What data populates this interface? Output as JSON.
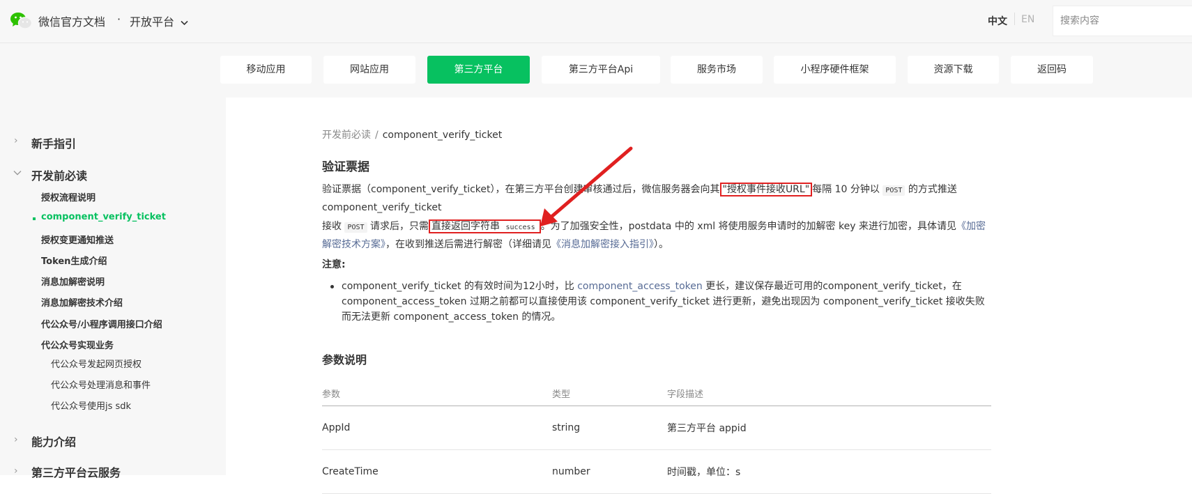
{
  "header": {
    "site_title": "微信官方文档",
    "separator": "·",
    "platform": "开放平台",
    "lang_zh": "中文",
    "lang_en": "EN",
    "search_placeholder": "搜索内容"
  },
  "product_nav": {
    "items": [
      "移动应用",
      "网站应用",
      "第三方平台",
      "第三方平台Api",
      "服务市场",
      "小程序硬件框架",
      "资源下载",
      "返回码"
    ],
    "active_index": 2
  },
  "sidebar": {
    "sections": [
      "新手指引",
      "开发前必读",
      "能力介绍",
      "第三方平台云服务"
    ],
    "sub_items": [
      "授权流程说明",
      "component_verify_ticket",
      "授权变更通知推送",
      "Token生成介绍",
      "消息加解密说明",
      "消息加解密技术介绍",
      "代公众号/小程序调用接口介绍",
      "代公众号实现业务"
    ],
    "sub_sub_items": [
      "代公众号发起网页授权",
      "代公众号处理消息和事件",
      "代公众号使用js sdk"
    ]
  },
  "content": {
    "breadcrumb_parent": "开发前必读",
    "breadcrumb_sep": "/",
    "breadcrumb_current": "component_verify_ticket",
    "title": "验证票据",
    "p1": {
      "a": "验证票据（component_verify_ticket），在第三方平台创建审核通过后，微信服务器会向其",
      "highlight": "\"授权事件接收URL\"",
      "b": "每隔 10 分钟以",
      "code": "POST",
      "c": "的方式推送 component_verify_ticket"
    },
    "p2": {
      "a": "接收",
      "code1": "POST",
      "b": "请求后，只需",
      "highlight_text": "直接返回字符串",
      "highlight_code": "success",
      "c": "。为了加强安全性，postdata 中的 xml 将使用服务申请时的加解密 key 来进行加密，具体请见",
      "link1": "《加密解密技术方案》",
      "d": "，在收到推送后需进行解密（详细请见",
      "link2": "《消息加解密接入指引》",
      "e": "）。"
    },
    "note_label": "注意:",
    "bullet": {
      "a": "component_verify_ticket 的有效时间为12小时，比",
      "link": "component_access_token",
      "b": "更长，建议保存最近可用的component_verify_ticket，在 component_access_token 过期之前都可以直接使用该 component_verify_ticket 进行更新，避免出现因为 component_verify_ticket 接收失败而无法更新 component_access_token 的情况。"
    },
    "params_title": "参数说明",
    "table": {
      "headers": [
        "参数",
        "类型",
        "字段描述"
      ],
      "rows": [
        [
          "AppId",
          "string",
          "第三方平台 appid"
        ],
        [
          "CreateTime",
          "number",
          "时间戳，单位：s"
        ]
      ]
    }
  },
  "colors": {
    "accent": "#07c160",
    "highlight_border": "#e02020",
    "link": "#576b95"
  }
}
